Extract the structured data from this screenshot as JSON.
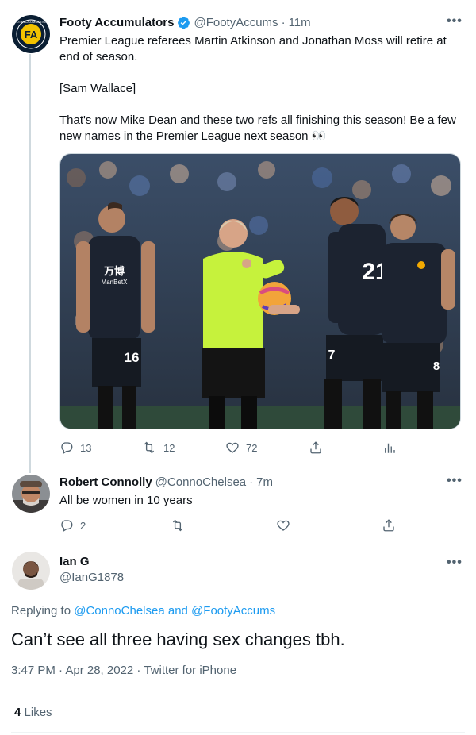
{
  "tweet1": {
    "name": "Footy Accumulators",
    "handle": "@FootyAccums",
    "time": "11m",
    "more": "•••",
    "text_p1": "Premier League referees Martin Atkinson and Jonathan Moss will retire at end of season.",
    "text_p2": "[Sam Wallace]",
    "text_p3": "That's now Mike Dean and these two refs all finishing this season! Be a few new names in the Premier League next season 👀",
    "replies": "13",
    "retweets": "12",
    "likes": "72",
    "photo_text": {
      "sponsor_a": "万博",
      "sponsor_b": "ManBetX",
      "number_left": "16",
      "number_mid": "21",
      "number_mid2": "7",
      "number_right": "8"
    }
  },
  "tweet2": {
    "name": "Robert Connolly",
    "handle": "@ConnoChelsea",
    "time": "7m",
    "more": "•••",
    "text": "All be women in 10 years",
    "replies": "2"
  },
  "tweet3": {
    "name": "Ian G",
    "handle": "@IanG1878",
    "more": "•••",
    "replying_prefix": "Replying to ",
    "replying_user1": "@ConnoChelsea",
    "replying_and": " and ",
    "replying_user2": "@FootyAccums",
    "text": "Can’t see all three having sex changes tbh.",
    "timestamp": "3:47 PM · Apr 28, 2022 · Twitter for iPhone",
    "likes_count": "4",
    "likes_label": "Likes"
  },
  "colors": {
    "accent": "#1d9bf0",
    "muted": "#536471",
    "verified": "#1d9bf0",
    "referee_shirt": "#c6f23c"
  }
}
